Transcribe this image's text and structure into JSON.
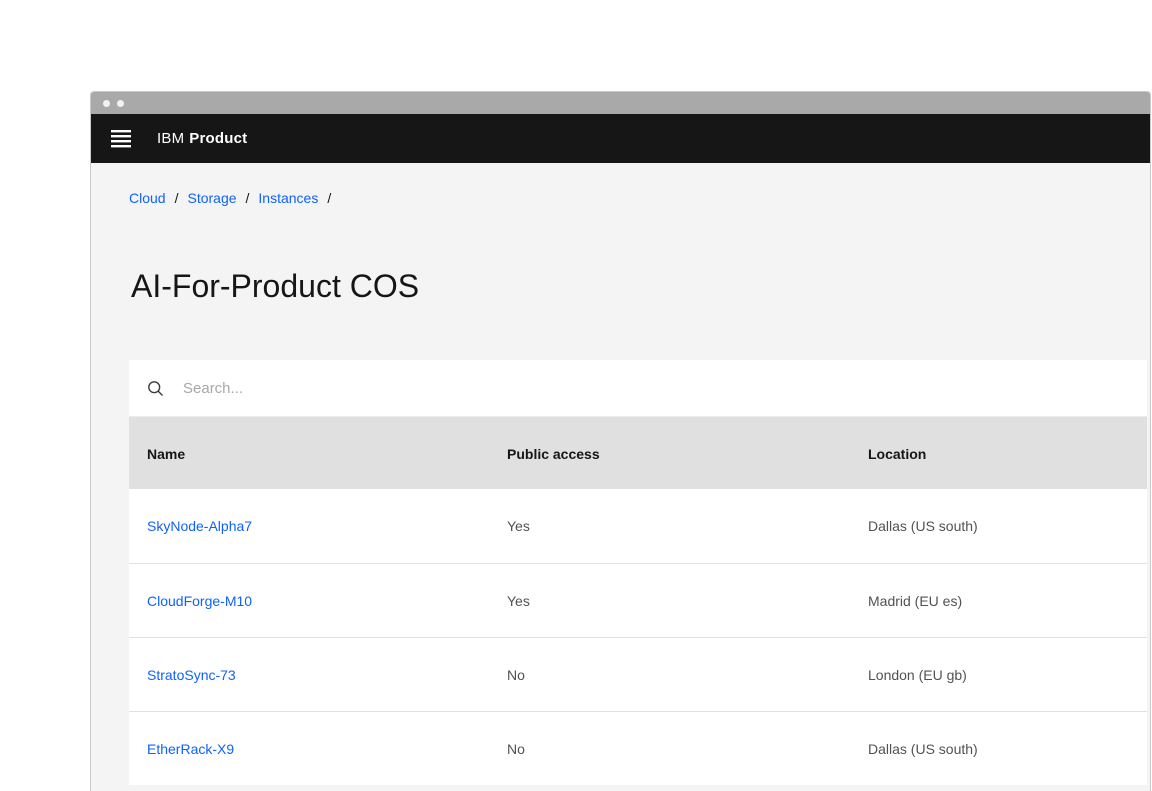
{
  "window": {
    "controls": [
      "dot",
      "dot"
    ]
  },
  "header": {
    "brand_prefix": "IBM",
    "brand_name": "Product"
  },
  "breadcrumb": {
    "items": [
      "Cloud",
      "Storage",
      "Instances"
    ],
    "separator": "/"
  },
  "page": {
    "title": "AI-For-Product COS"
  },
  "table": {
    "search": {
      "placeholder": "Search...",
      "icon": "search-icon"
    },
    "columns": [
      "Name",
      "Public access",
      "Location"
    ],
    "rows": [
      {
        "name": "SkyNode-Alpha7",
        "public_access": "Yes",
        "location": "Dallas (US south)"
      },
      {
        "name": "CloudForge-M10",
        "public_access": "Yes",
        "location": "Madrid (EU es)"
      },
      {
        "name": "StratoSync-73",
        "public_access": "No",
        "location": "London (EU gb)"
      },
      {
        "name": "EtherRack-X9",
        "public_access": "No",
        "location": "Dallas (US south)"
      }
    ]
  },
  "colors": {
    "link": "#0f62fe",
    "app_header_bg": "#161616",
    "titlebar_bg": "#a9a9a9",
    "page_bg": "#f4f4f4",
    "table_header_bg": "#e0e0e0",
    "secondary_text": "#525252"
  }
}
